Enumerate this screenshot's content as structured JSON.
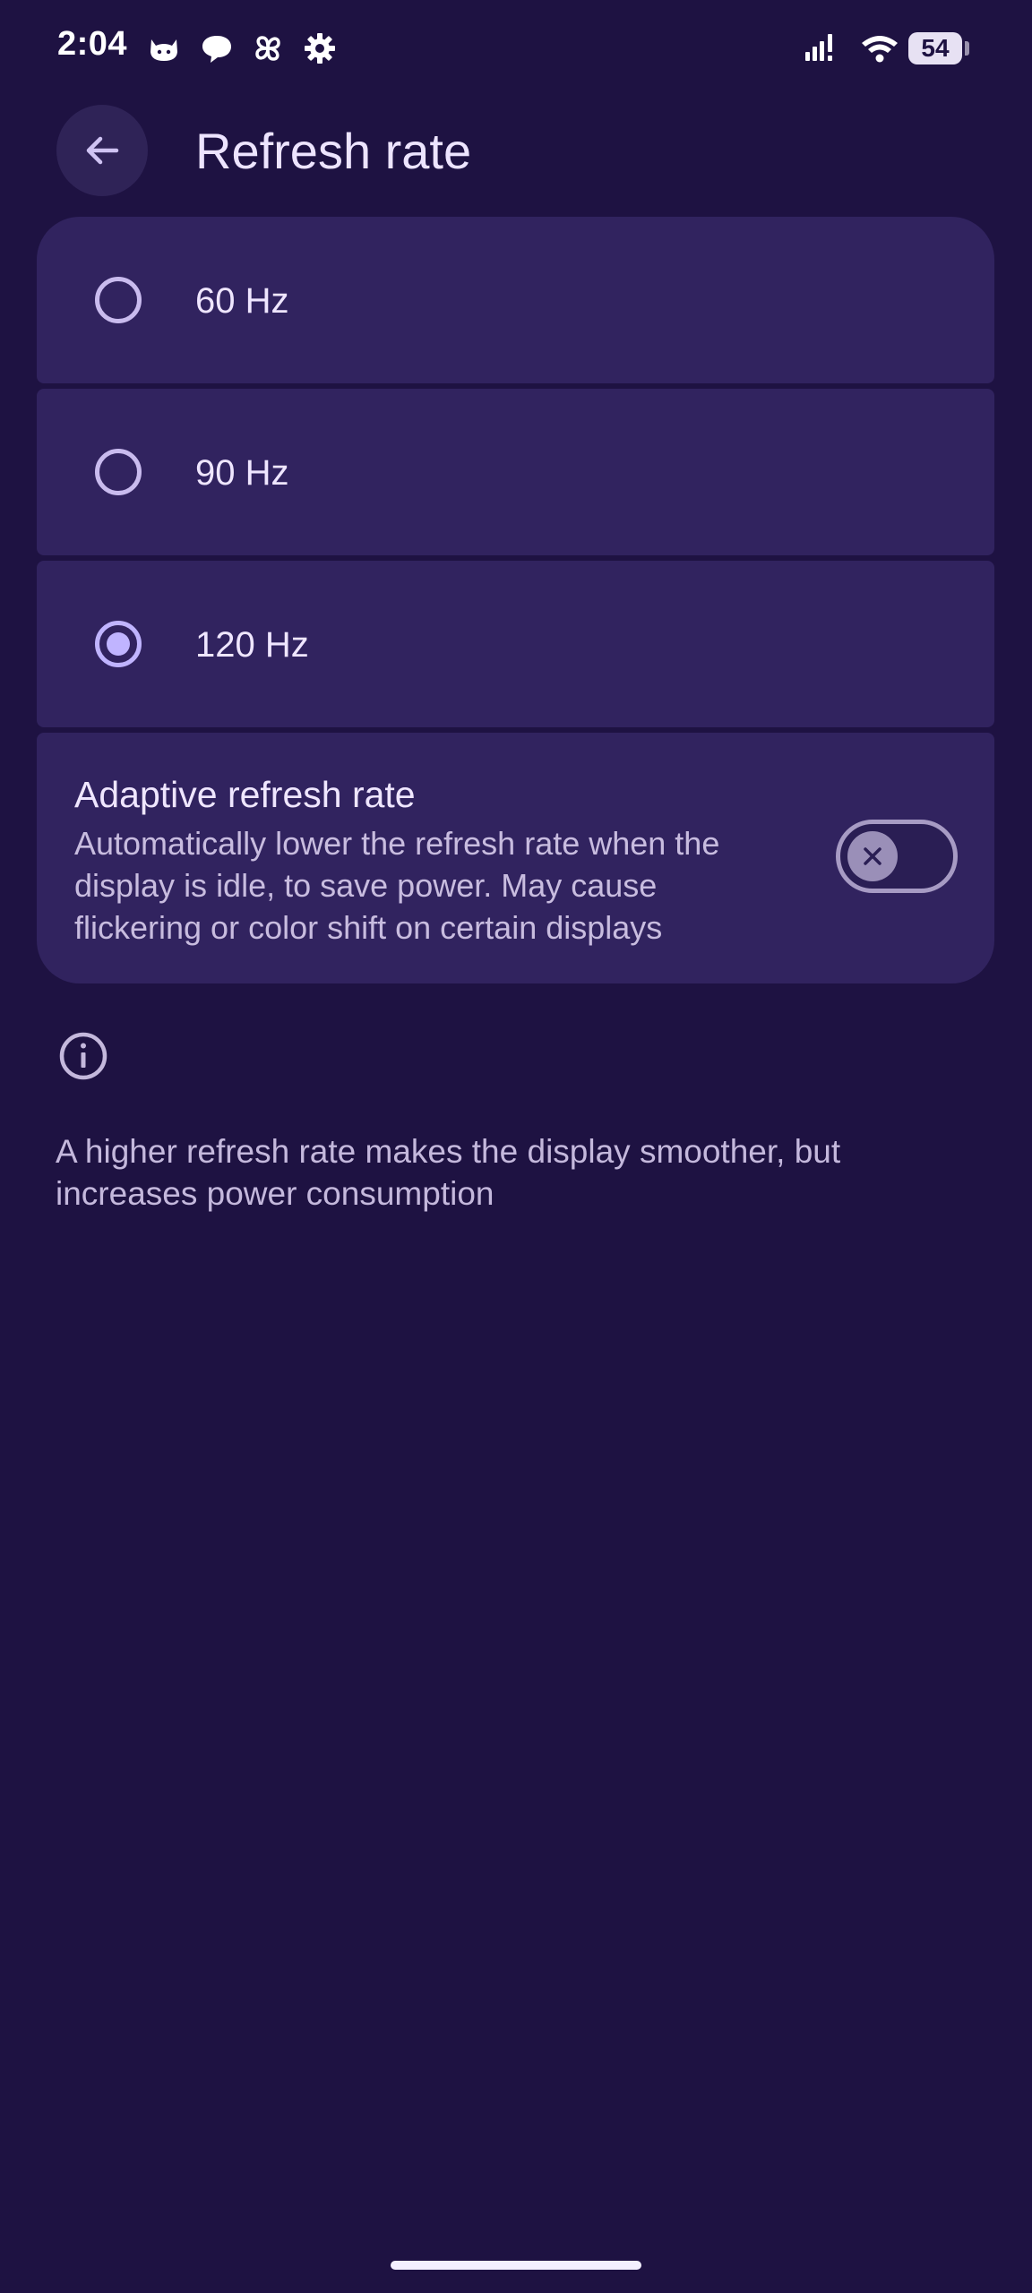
{
  "status_bar": {
    "time": "2:04",
    "battery": "54",
    "icons": [
      "cat-app-icon",
      "chat-bubble-icon",
      "pinwheel-icon",
      "gear-icon",
      "signal-icon",
      "wifi-icon",
      "battery-icon"
    ]
  },
  "header": {
    "back_icon": "arrow-left-icon",
    "title": "Refresh rate"
  },
  "options": [
    {
      "label": "60 Hz",
      "selected": false
    },
    {
      "label": "90 Hz",
      "selected": false
    },
    {
      "label": "120 Hz",
      "selected": true
    }
  ],
  "adaptive": {
    "title": "Adaptive refresh rate",
    "description": "Automatically lower the refresh rate when the display is idle, to save power. May cause flickering or color shift on certain displays",
    "enabled": false
  },
  "info": {
    "icon": "info-icon",
    "text": "A higher refresh rate makes the display smoother, but increases power consumption"
  },
  "colors": {
    "background": "#1e1242",
    "card": "#31235f",
    "accent": "#c0b4ff"
  }
}
